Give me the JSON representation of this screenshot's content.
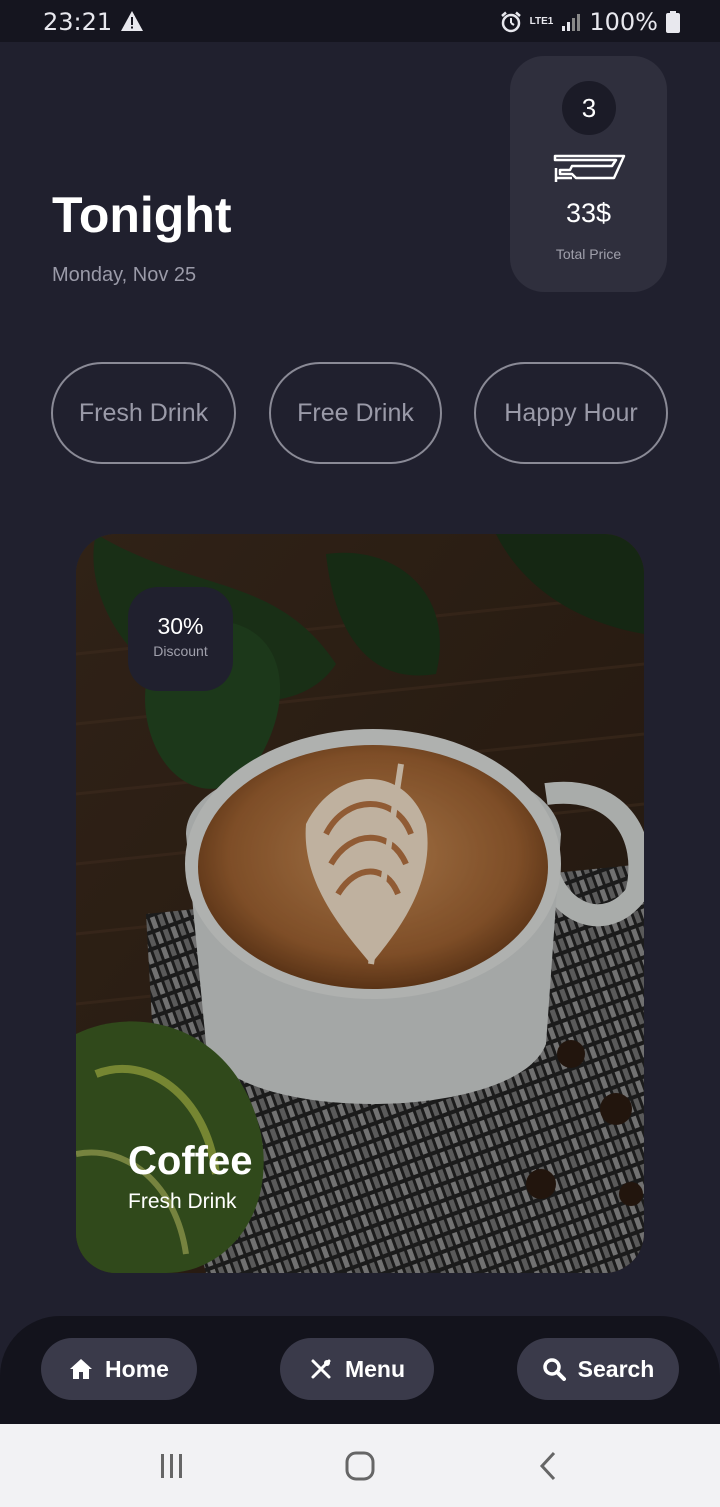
{
  "status_bar": {
    "time": "23:21",
    "battery": "100%",
    "network": "LTE1"
  },
  "header": {
    "title": "Tonight",
    "date": "Monday, Nov 25"
  },
  "cart": {
    "count": "3",
    "price": "33$",
    "label": "Total Price",
    "icon": "cart-hand-icon"
  },
  "categories": [
    {
      "label": "Fresh Drink"
    },
    {
      "label": "Free Drink"
    },
    {
      "label": "Happy Hour"
    }
  ],
  "promo": {
    "discount_value": "30%",
    "discount_label": "Discount",
    "name": "Coffee",
    "subtitle": "Fresh Drink"
  },
  "bottom_nav": {
    "home_label": "Home",
    "menu_label": "Menu",
    "search_label": "Search"
  },
  "colors": {
    "background": "#20202e",
    "card": "#2f2f3d",
    "nav_button": "#3a3a4a",
    "chip_border": "#8a8a96"
  }
}
